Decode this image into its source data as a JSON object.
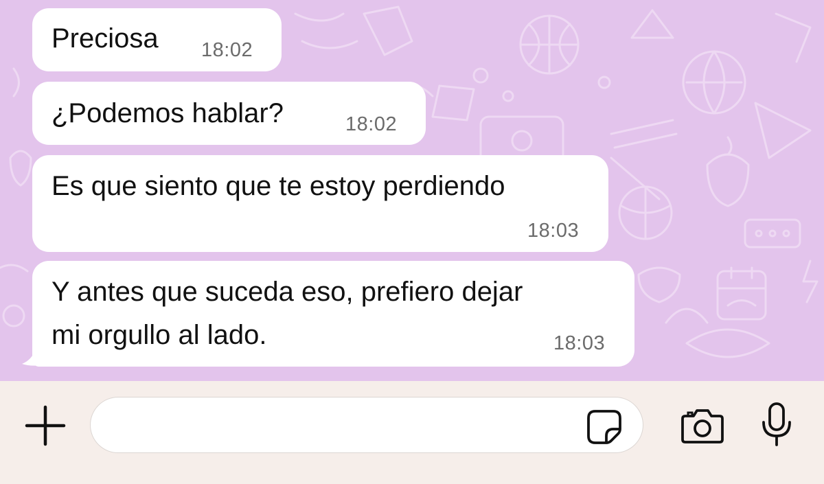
{
  "messages": [
    {
      "text": "Preciosa",
      "time": "18:02"
    },
    {
      "text": "¿Podemos hablar?",
      "time": "18:02"
    },
    {
      "text": "Es que siento que te estoy perdiendo",
      "time": "18:03"
    },
    {
      "text_line1": "Y antes que suceda eso, prefiero dejar",
      "text_line2": "mi orgullo al lado.",
      "time": "18:03"
    }
  ],
  "composer": {
    "placeholder": "",
    "attach_icon": "plus-icon",
    "sticker_icon": "sticker-icon",
    "camera_icon": "camera-icon",
    "mic_icon": "microphone-icon"
  },
  "colors": {
    "chat_background": "#e3c4ec",
    "bubble": "#ffffff",
    "bottom_bar": "#f6eeea",
    "time_text": "#6b6b6b"
  }
}
